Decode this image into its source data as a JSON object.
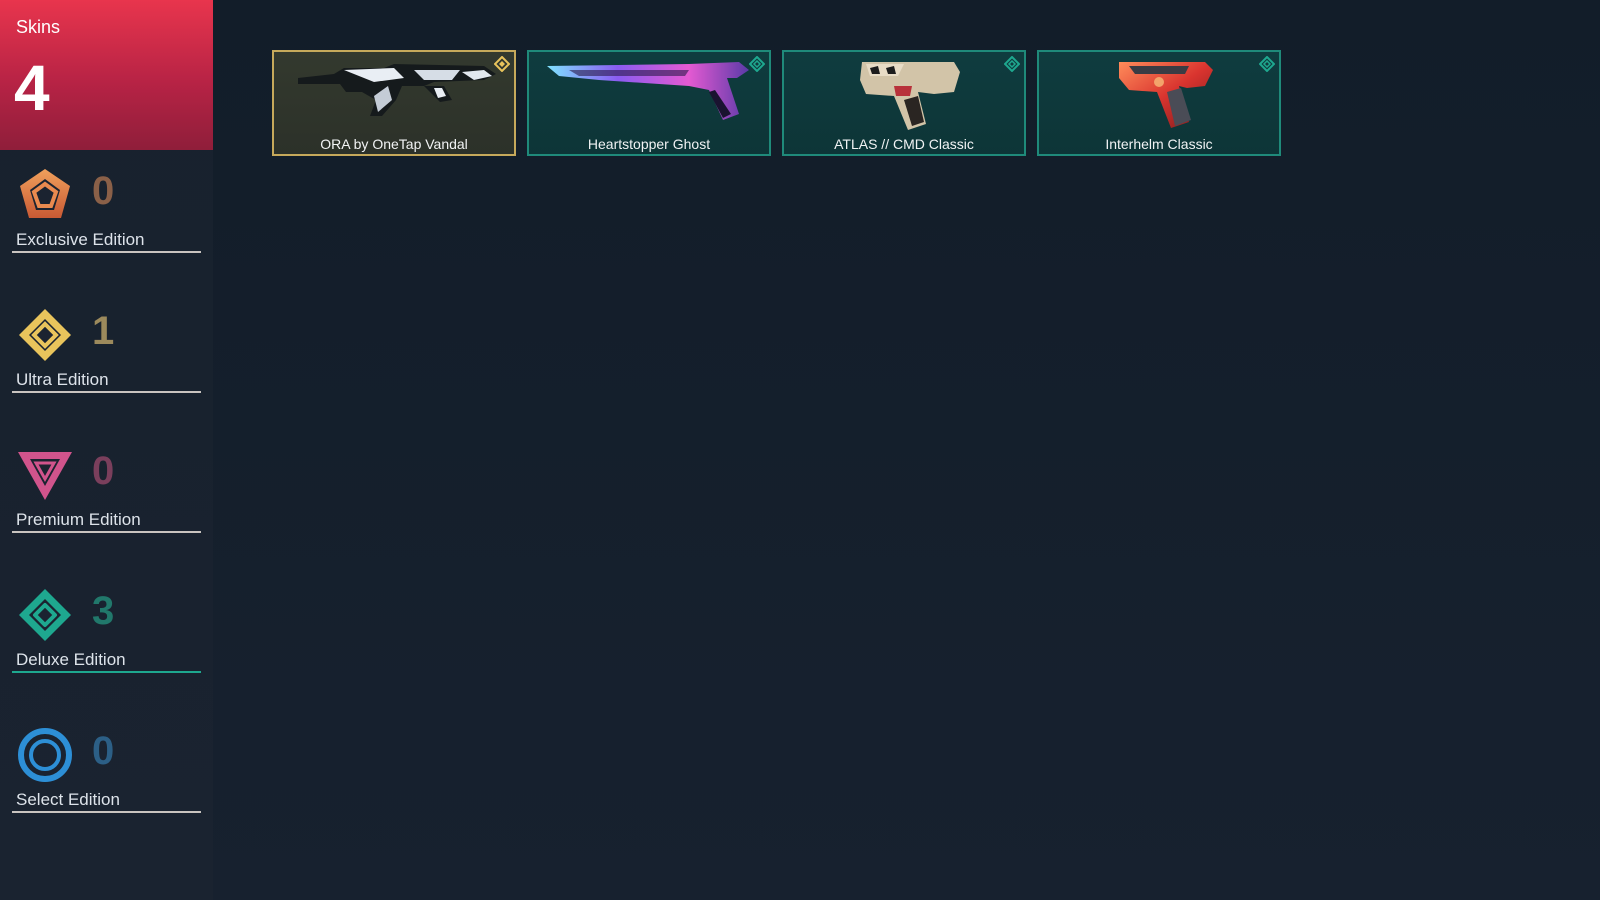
{
  "skins": {
    "title": "Skins",
    "count": "4"
  },
  "tiers": [
    {
      "label": "Exclusive Edition",
      "count": "0",
      "color": "#e0804a",
      "count_color": "#8a6048",
      "icon": "exclusive-edition-icon"
    },
    {
      "label": "Ultra Edition",
      "count": "1",
      "color": "#e9c45c",
      "count_color": "#9c8a5c",
      "icon": "ultra-edition-icon"
    },
    {
      "label": "Premium Edition",
      "count": "0",
      "color": "#d1548c",
      "count_color": "#7a3f5c",
      "icon": "premium-edition-icon"
    },
    {
      "label": "Deluxe Edition",
      "count": "3",
      "color": "#1ea88f",
      "count_color": "#21786b",
      "icon": "deluxe-edition-icon"
    },
    {
      "label": "Select Edition",
      "count": "0",
      "color": "#2d8fd6",
      "count_color": "#2c5f86",
      "icon": "select-edition-icon"
    }
  ],
  "skins_list": [
    {
      "name": "ORA by OneTap Vandal",
      "tier": "ultra",
      "icon": "vandal-rifle-image"
    },
    {
      "name": "Heartstopper Ghost",
      "tier": "deluxe",
      "icon": "ghost-pistol-image"
    },
    {
      "name": "ATLAS // CMD Classic",
      "tier": "deluxe",
      "icon": "classic-pistol-image"
    },
    {
      "name": "Interhelm Classic",
      "tier": "deluxe",
      "icon": "classic-pistol-image"
    }
  ]
}
